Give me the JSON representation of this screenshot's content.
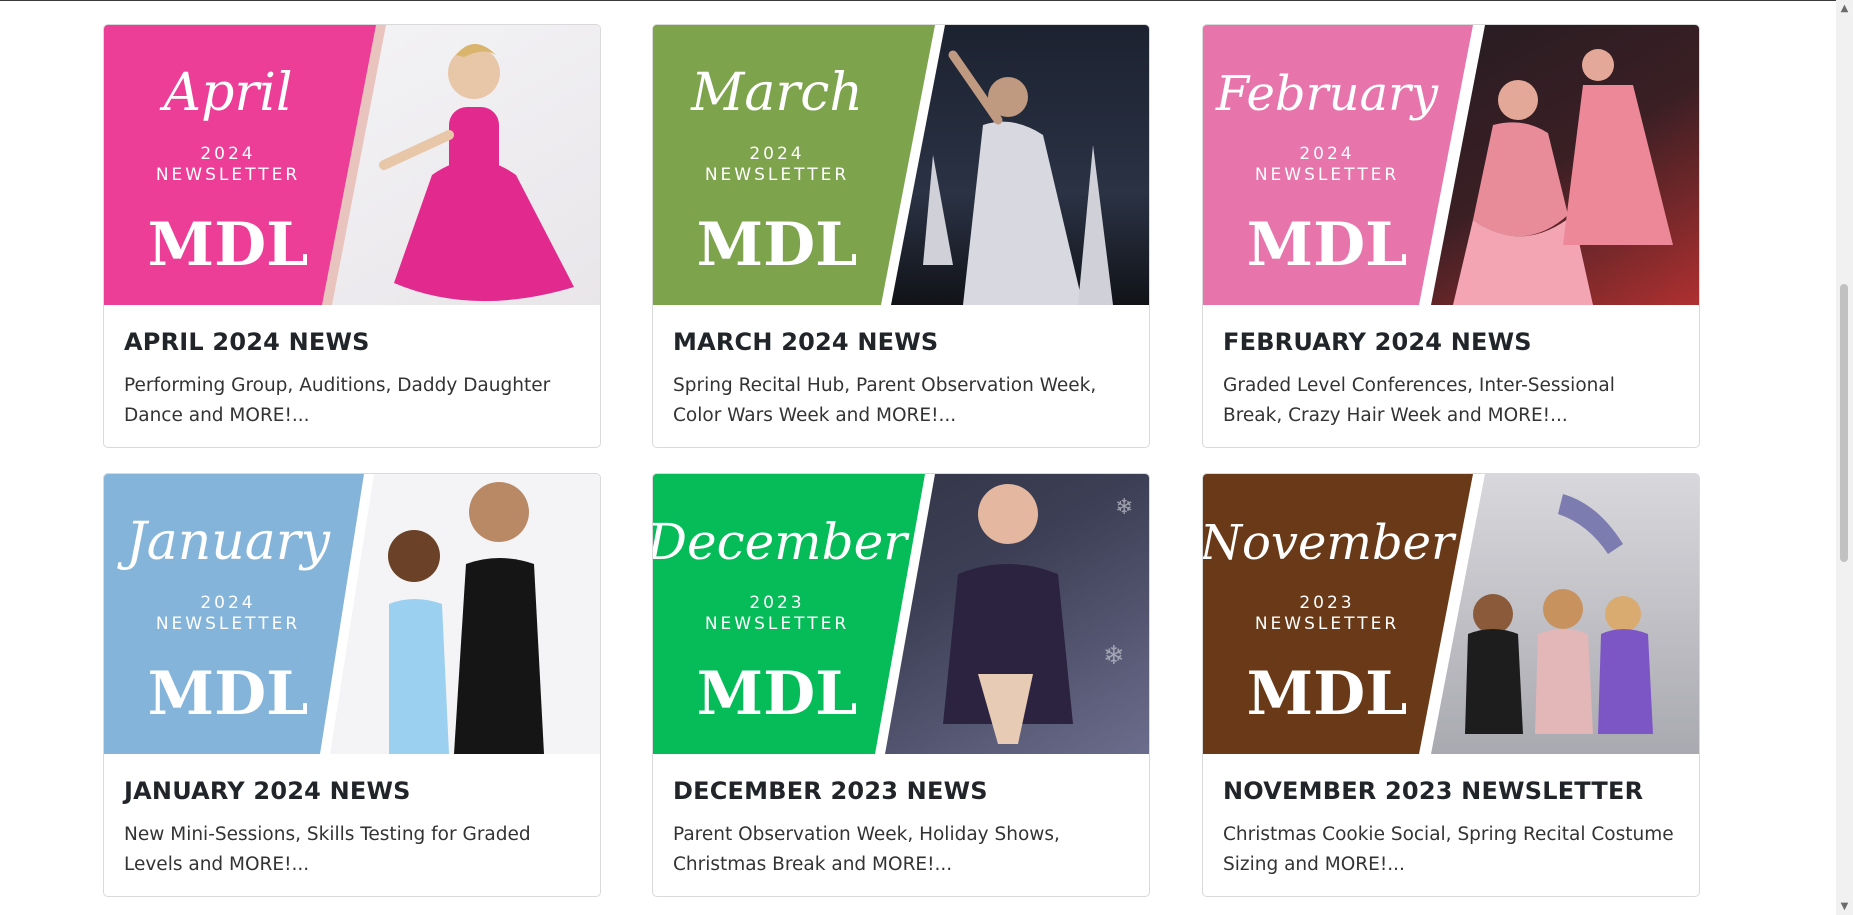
{
  "cards": [
    {
      "month": "April",
      "year": "2024",
      "newsletter": "NEWSLETTER",
      "logo": "MDL",
      "title": "APRIL 2024 NEWS",
      "text": "Performing Group, Auditions, Daddy Daughter Dance and MORE!...",
      "accent": "#ec3d97"
    },
    {
      "month": "March",
      "year": "2024",
      "newsletter": "NEWSLETTER",
      "logo": "MDL",
      "title": "MARCH 2024 NEWS",
      "text": "Spring Recital Hub, Parent Observation Week, Color Wars Week and MORE!...",
      "accent": "#7ea34d"
    },
    {
      "month": "February",
      "year": "2024",
      "newsletter": "NEWSLETTER",
      "logo": "MDL",
      "title": "FEBRUARY 2024 NEWS",
      "text": "Graded Level Conferences, Inter-Sessional Break, Crazy Hair Week and MORE!...",
      "accent": "#e874ac"
    },
    {
      "month": "January",
      "year": "2024",
      "newsletter": "NEWSLETTER",
      "logo": "MDL",
      "title": "JANUARY 2024 NEWS",
      "text": "New Mini-Sessions, Skills Testing for Graded Levels and MORE!...",
      "accent": "#85b4da"
    },
    {
      "month": "December",
      "year": "2023",
      "newsletter": "NEWSLETTER",
      "logo": "MDL",
      "title": "DECEMBER 2023 NEWS",
      "text": "Parent Observation Week, Holiday Shows, Christmas Break and MORE!...",
      "accent": "#05bc58"
    },
    {
      "month": "November",
      "year": "2023",
      "newsletter": "NEWSLETTER",
      "logo": "MDL",
      "title": "NOVEMBER 2023 NEWSLETTER",
      "text": "Christmas Cookie Social, Spring Recital Costume Sizing and MORE!...",
      "accent": "#6a3a18"
    }
  ],
  "scrollbar": {
    "up_arrow": "▲",
    "down_arrow": "▼"
  }
}
